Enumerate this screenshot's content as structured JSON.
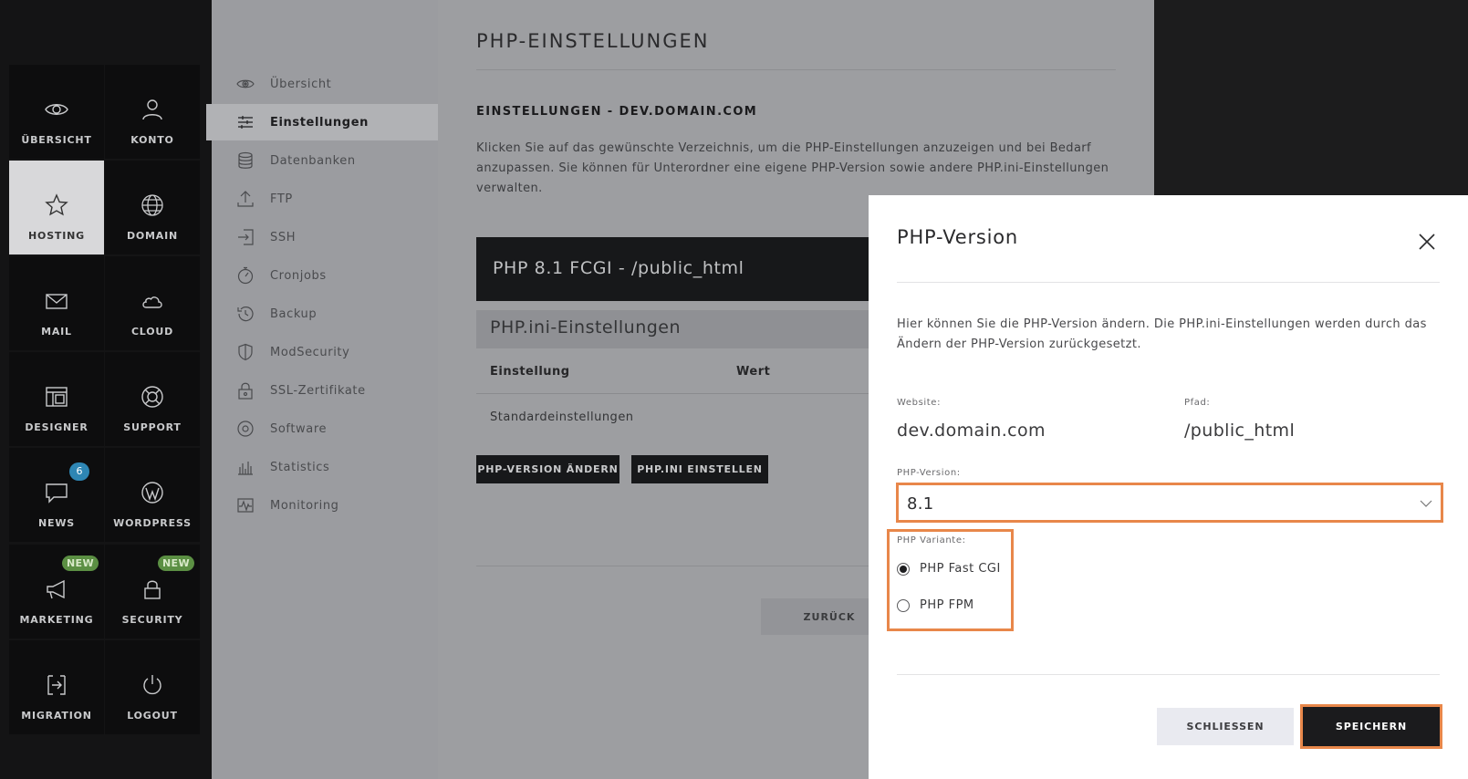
{
  "tilenav": {
    "items": [
      {
        "label": "ÜBERSICHT",
        "icon": "eye-icon"
      },
      {
        "label": "KONTO",
        "icon": "user-icon"
      },
      {
        "label": "HOSTING",
        "icon": "star-icon",
        "active": true
      },
      {
        "label": "DOMAIN",
        "icon": "globe-icon"
      },
      {
        "label": "MAIL",
        "icon": "envelope-icon"
      },
      {
        "label": "CLOUD",
        "icon": "cloud-icon"
      },
      {
        "label": "DESIGNER",
        "icon": "layout-icon"
      },
      {
        "label": "SUPPORT",
        "icon": "lifebuoy-icon"
      },
      {
        "label": "NEWS",
        "icon": "chat-bubble-icon",
        "badge": "6"
      },
      {
        "label": "WORDPRESS",
        "icon": "wordpress-icon"
      },
      {
        "label": "MARKETING",
        "icon": "megaphone-icon",
        "badge": "NEW"
      },
      {
        "label": "SECURITY",
        "icon": "lock-icon",
        "badge": "NEW"
      },
      {
        "label": "MIGRATION",
        "icon": "migration-icon"
      },
      {
        "label": "LOGOUT",
        "icon": "power-icon"
      }
    ]
  },
  "subnav": {
    "items": [
      {
        "label": "Übersicht",
        "icon": "eye-icon"
      },
      {
        "label": "Einstellungen",
        "icon": "sliders-icon",
        "active": true
      },
      {
        "label": "Datenbanken",
        "icon": "database-icon"
      },
      {
        "label": "FTP",
        "icon": "upload-icon"
      },
      {
        "label": "SSH",
        "icon": "login-icon"
      },
      {
        "label": "Cronjobs",
        "icon": "stopwatch-icon"
      },
      {
        "label": "Backup",
        "icon": "history-icon"
      },
      {
        "label": "ModSecurity",
        "icon": "shield-icon"
      },
      {
        "label": "SSL-Zertifikate",
        "icon": "padlock-icon"
      },
      {
        "label": "Software",
        "icon": "disc-icon"
      },
      {
        "label": "Statistics",
        "icon": "bar-chart-icon"
      },
      {
        "label": "Monitoring",
        "icon": "pulse-icon"
      }
    ]
  },
  "main": {
    "page_title": "PHP-EINSTELLUNGEN",
    "section_title": "EINSTELLUNGEN - DEV.DOMAIN.COM",
    "section_desc": "Klicken Sie auf das gewünschte Verzeichnis, um die PHP-Einstellungen anzuzeigen und bei Bedarf anzupassen. Sie können für Unterordner eine eigene PHP-Version sowie andere PHP.ini-Einstellungen verwalten.",
    "php_header": "PHP 8.1 FCGI - /public_html",
    "ini_header": "PHP.ini-Einstellungen",
    "table": {
      "col_setting": "Einstellung",
      "col_value": "Wert",
      "row_default": "Standardeinstellungen"
    },
    "btn_php_version": "PHP-VERSION ÄNDERN",
    "btn_php_ini": "PHP.INI EINSTELLEN",
    "btn_back": "ZURÜCK"
  },
  "modal": {
    "title": "PHP-Version",
    "description": "Hier können Sie die PHP-Version ändern. Die PHP.ini-Einstellungen werden durch das Ändern der PHP-Version zurückgesetzt.",
    "website_label": "Website:",
    "website_value": "dev.domain.com",
    "path_label": "Pfad:",
    "path_value": "/public_html",
    "version_label": "PHP-Version:",
    "version_value": "8.1",
    "variant_label": "PHP Variante:",
    "variants": [
      {
        "label": "PHP Fast CGI",
        "selected": true
      },
      {
        "label": "PHP FPM",
        "selected": false
      }
    ],
    "btn_close": "SCHLIESSEN",
    "btn_save": "SPEICHERN",
    "highlight_color": "#e8874a"
  },
  "colors": {
    "tile_bg": "#0d0d0e",
    "tile_active_bg": "#d8d8da",
    "badge_blue": "#2e86b4",
    "badge_green": "#5b8f43",
    "dark_button": "#17181a",
    "accent_orange": "#e8874a"
  }
}
